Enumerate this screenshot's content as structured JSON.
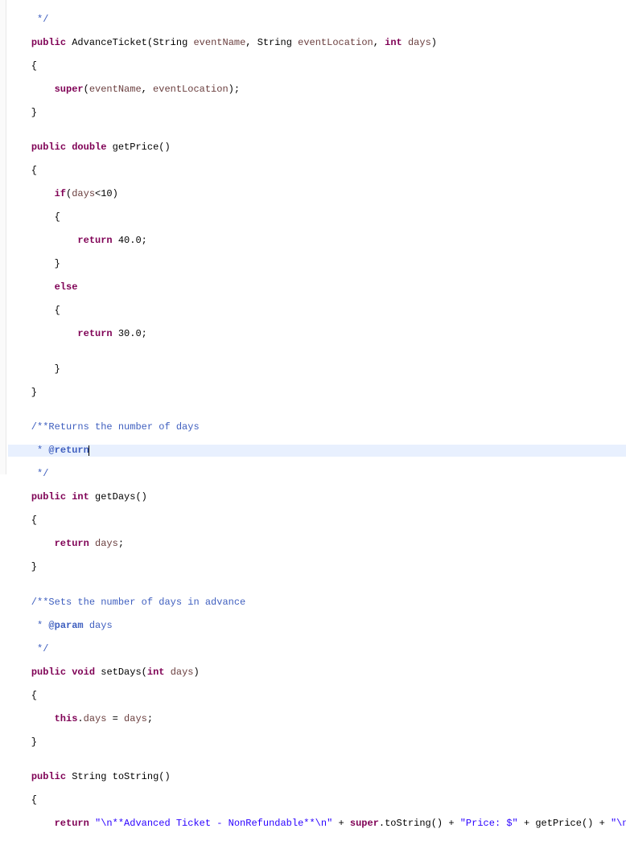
{
  "code": {
    "l0": "     */",
    "l1_kw1": "public",
    "l1_type": "AdvanceTicket",
    "l1_p1t": "String",
    "l1_p1n": "eventName",
    "l1_p2t": "String",
    "l1_p2n": "eventLocation",
    "l1_p3t": "int",
    "l1_p3n": "days",
    "l2": "    {",
    "l3_kw": "super",
    "l3_args_a": "eventName",
    "l3_args_b": "eventLocation",
    "l4": "    }",
    "blank": "",
    "l6_kw1": "public",
    "l6_kw2": "double",
    "l6_m": "getPrice",
    "l7": "    {",
    "l8_kw": "if",
    "l8_f": "days",
    "l8_op": "<10)",
    "l9": "        {",
    "l10_kw": "return",
    "l10_v": "40.0",
    "l11": "        }",
    "l12_kw": "else",
    "l13": "        {",
    "l14_kw": "return",
    "l14_v": "30.0",
    "l15": "",
    "l16": "        }",
    "l17": "    }",
    "c1a": "    /**",
    "c1b": "Returns the number of days",
    "c2a": "     * ",
    "c2tag": "@return",
    "c3": "     */",
    "l20_kw1": "public",
    "l20_kw2": "int",
    "l20_m": "getDays",
    "l21": "    {",
    "l22_kw": "return",
    "l22_f": "days",
    "l23": "    }",
    "c4a": "    /**",
    "c4b": "Sets the number of days in advance",
    "c5a": "     * ",
    "c5tag": "@param",
    "c5p": " days",
    "c6": "     */",
    "l27_kw1": "public",
    "l27_kw2": "void",
    "l27_m": "setDays",
    "l27_pt": "int",
    "l27_pn": "days",
    "l28": "    {",
    "l29_kw": "this",
    "l29_f": "days",
    "l29_eq": " = ",
    "l29_p": "days",
    "l30": "    }",
    "l32_kw1": "public",
    "l32_t": "String",
    "l32_m": "toString",
    "l33": "    {",
    "l34_kw": "return",
    "l34_s1": "\"\\n**Advanced Ticket - NonRefundable**\\n\"",
    "l34_plus": " + ",
    "l34_kw2": "super",
    "l34_ts": ".toString() + ",
    "l34_s2": "\"Price: $\"",
    "l34_gp": " + getPrice() + ",
    "l34_s3": "\"\\n\"",
    "l34_semi": ";"
  }
}
